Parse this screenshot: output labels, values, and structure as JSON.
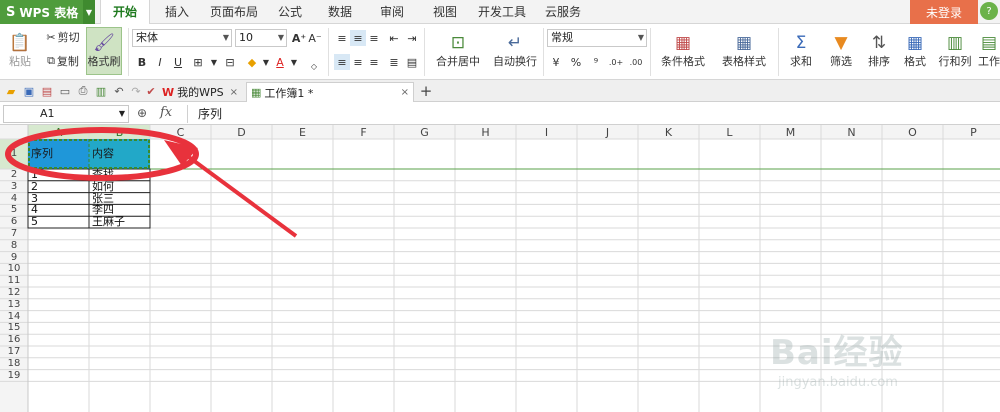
{
  "app": {
    "logo": "S",
    "name": "WPS 表格"
  },
  "menu": [
    "开始",
    "插入",
    "页面布局",
    "公式",
    "数据",
    "审阅",
    "视图",
    "开发工具",
    "云服务"
  ],
  "login_label": "未登录",
  "ribbon": {
    "paste": "粘贴",
    "cut": "剪切",
    "copy": "复制",
    "format_painter": "格式刷",
    "font_name": "宋体",
    "font_size": "10",
    "bold": "B",
    "italic": "I",
    "underline": "U",
    "merge_center": "合并居中",
    "wrap_text": "自动换行",
    "number_format": "常规",
    "currency": "¥",
    "percent": "%",
    "comma": "⁹",
    "cond_format": "条件格式",
    "table_style": "表格样式",
    "sum": "求和",
    "filter": "筛选",
    "sort": "排序",
    "format": "格式",
    "rows_cols": "行和列",
    "worksheet": "工作"
  },
  "doc_tabs": [
    {
      "label": "我的WPS",
      "close": "×"
    },
    {
      "label": "工作簿1 *",
      "close": "×"
    }
  ],
  "new_tab": "+",
  "formula_bar": {
    "name_box": "A1",
    "zoom_icon": "⊕",
    "fx": "fx",
    "content": "序列"
  },
  "columns": [
    "A",
    "B",
    "C",
    "D",
    "E",
    "F",
    "G",
    "H",
    "I",
    "J",
    "K",
    "L",
    "M",
    "N",
    "O",
    "P"
  ],
  "rows": [
    "1",
    "2",
    "3",
    "4",
    "5",
    "6",
    "7",
    "8",
    "9",
    "10",
    "11",
    "12",
    "13",
    "14",
    "15",
    "16",
    "17",
    "18",
    "19"
  ],
  "table": {
    "header": [
      "序列",
      "内容"
    ],
    "body": [
      [
        "1",
        "查找"
      ],
      [
        "2",
        "如何"
      ],
      [
        "3",
        "张三"
      ],
      [
        "4",
        "李四"
      ],
      [
        "5",
        "王麻子"
      ]
    ]
  },
  "colors": {
    "header_fill": "#1f97d9",
    "accent_green": "#4f9c3c",
    "annotation": "#e8323c",
    "login": "#e8704a"
  },
  "watermark": {
    "brand": "Bai经验",
    "url": "jingyan.baidu.com"
  }
}
